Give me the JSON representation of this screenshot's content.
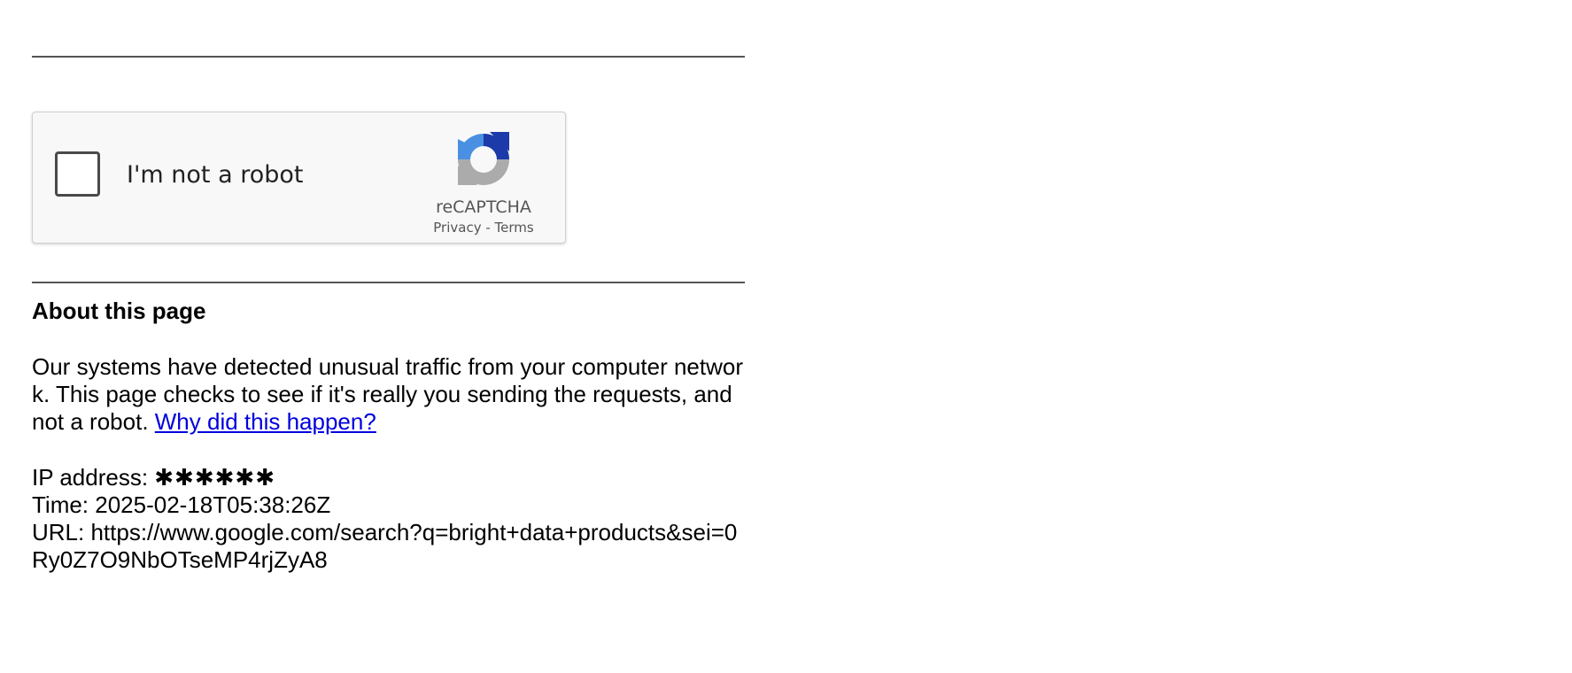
{
  "captcha": {
    "checkbox_label": "I'm not a robot",
    "brand": "reCAPTCHA",
    "privacy_link": "Privacy",
    "separator": " - ",
    "terms_link": "Terms"
  },
  "about": {
    "title": "About this page",
    "text": "Our systems have detected unusual traffic from your computer network. This page checks to see if it's really you sending the requests, and not a robot. ",
    "link": "Why did this happen?"
  },
  "info": {
    "ip_label": "IP address: ",
    "ip_value": "✱✱✱✱✱✱",
    "time_label": "Time: ",
    "time_value": "2025-02-18T05:38:26Z",
    "url_label": "URL: ",
    "url_value": "https://www.google.com/search?q=bright+data+products&sei=0Ry0Z7O9NbOTseMP4rjZyA8"
  },
  "colors": {
    "link": "#0000dd",
    "recaptcha_blue_dark": "#1c3aa9",
    "recaptcha_blue_light": "#4a90e2",
    "recaptcha_gray": "#ababab"
  }
}
